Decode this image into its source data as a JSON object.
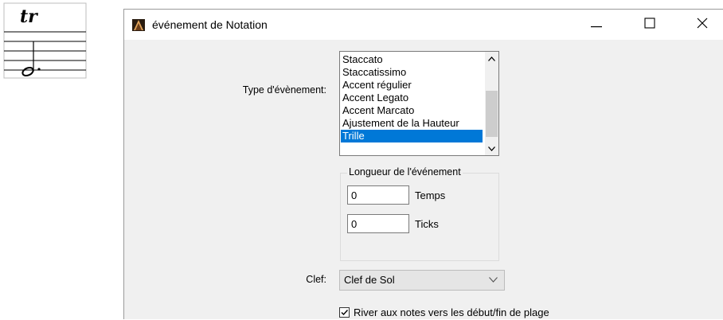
{
  "notation_thumbnail": {
    "symbol_text": "tr"
  },
  "dialog": {
    "title": "événement de Notation",
    "controls": {
      "minimize_glyph": "—",
      "maximize_glyph": "☐",
      "close_glyph": "✕"
    },
    "event_type": {
      "label": "Type d'évènement:",
      "items": [
        "Staccato",
        "Staccatissimo",
        "Accent régulier",
        "Accent Legato",
        "Accent Marcato",
        "Ajustement de la Hauteur",
        "Trille"
      ],
      "selected": "Trille"
    },
    "event_length": {
      "legend": "Longueur de l'événement",
      "beats_value": "0",
      "beats_label": "Temps",
      "ticks_value": "0",
      "ticks_label": "Ticks"
    },
    "clef": {
      "label": "Clef:",
      "value": "Clef de Sol"
    },
    "snap_option": {
      "checked": true,
      "label": "River aux notes vers les début/fin de plage"
    }
  }
}
